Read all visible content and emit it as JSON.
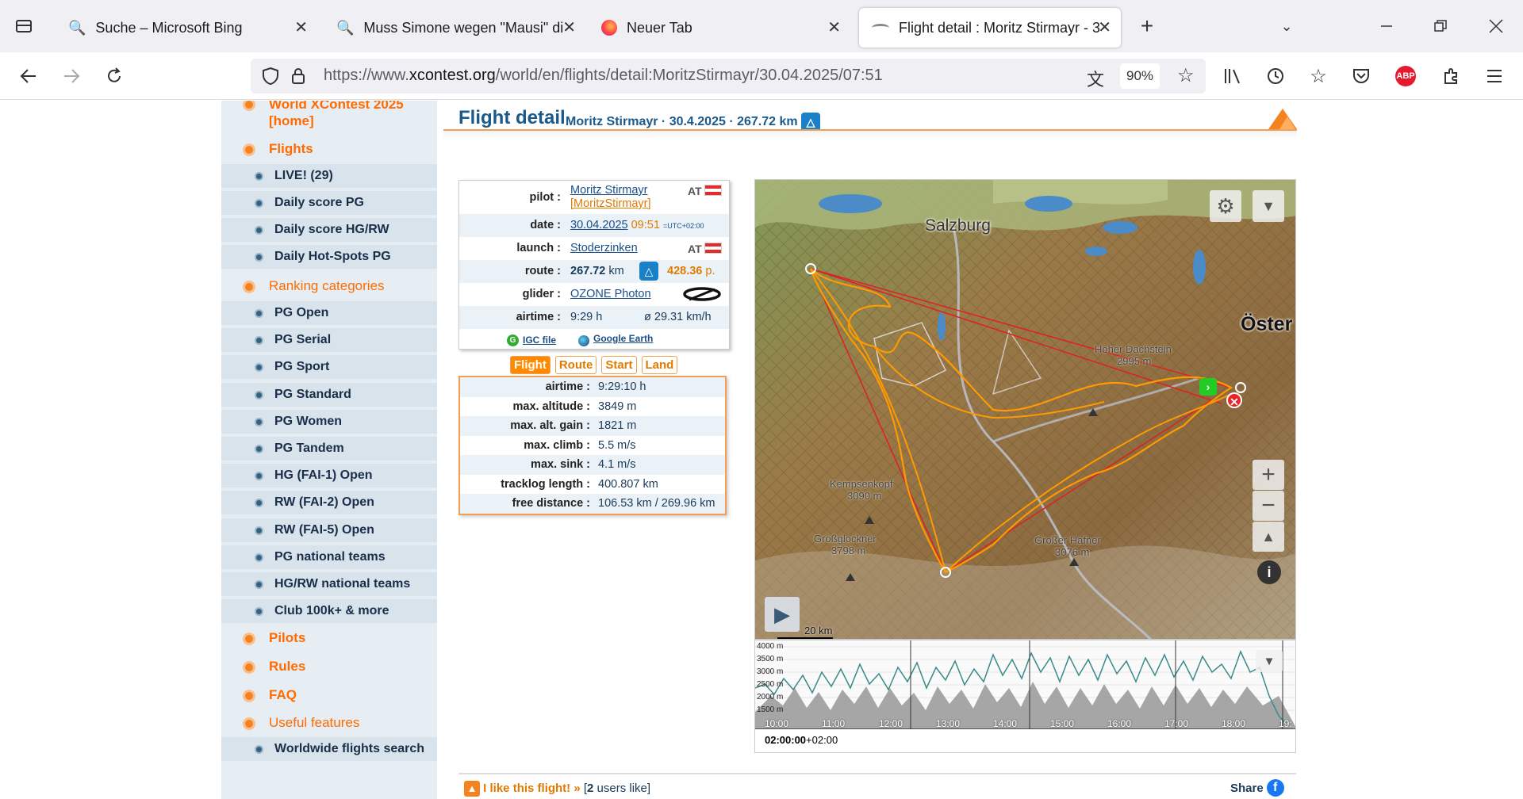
{
  "browser": {
    "tabs": [
      {
        "title": "Suche – Microsoft Bing",
        "icon": "search-icon"
      },
      {
        "title": "Muss Simone wegen \"Mausi\" di",
        "icon": "search-icon"
      },
      {
        "title": "Neuer Tab",
        "icon": "firefox-icon"
      },
      {
        "title": "Flight detail : Moritz Stirmayr - 3",
        "icon": "xcontest-icon"
      }
    ],
    "url_prefix": "https://www.",
    "url_domain": "xcontest.org",
    "url_path": "/world/en/flights/detail:MoritzStirmayr/30.04.2025/07:51",
    "zoom": "90%",
    "abp_label": "ABP"
  },
  "sidebar": {
    "home": "World XContest 2025 [home]",
    "flights": "Flights",
    "flight_items": [
      "LIVE! (29)",
      "Daily score PG",
      "Daily score HG/RW",
      "Daily Hot-Spots PG"
    ],
    "ranking": "Ranking categories",
    "ranking_items": [
      "PG Open",
      "PG Serial",
      "PG Sport",
      "PG Standard",
      "PG Women",
      "PG Tandem",
      "HG (FAI-1) Open",
      "RW (FAI-2) Open",
      "RW (FAI-5) Open",
      "PG national teams",
      "HG/RW national teams",
      "Club 100k+ & more"
    ],
    "pilots": "Pilots",
    "rules": "Rules",
    "faq": "FAQ",
    "useful": "Useful features",
    "useful_items": [
      "Worldwide flights search"
    ]
  },
  "header": {
    "title": "Flight detail",
    "subtitle": "Moritz Stirmayr · 30.4.2025 · 267.72 km"
  },
  "info": {
    "pilot_label": "pilot :",
    "pilot_name": "Moritz Stirmayr",
    "pilot_user": "[MoritzStirmayr]",
    "country": "AT",
    "date_label": "date :",
    "date": "30.04.2025",
    "time": "09:51",
    "tz": "=UTC+02:00",
    "launch_label": "launch :",
    "launch": "Stoderzinken",
    "route_label": "route :",
    "route_km": "267.72",
    "route_unit": "km",
    "route_points": "428.36",
    "points_unit": "p.",
    "glider_label": "glider :",
    "glider": "OZONE Photon",
    "airtime_label": "airtime :",
    "airtime": "9:29 h",
    "speed": "ø 29.31 km/h",
    "igc": "IGC file",
    "google_earth": "Google Earth"
  },
  "flight_tabs": [
    "Flight",
    "Route",
    "Start",
    "Land"
  ],
  "stats": [
    {
      "label": "airtime :",
      "value": "9:29:10 h"
    },
    {
      "label": "max. altitude :",
      "value": "3849 m"
    },
    {
      "label": "max. alt. gain :",
      "value": "1821 m"
    },
    {
      "label": "max. climb :",
      "value": "5.5 m/s"
    },
    {
      "label": "max. sink :",
      "value": "4.1 m/s"
    },
    {
      "label": "tracklog length :",
      "value": "400.807 km"
    },
    {
      "label": "free distance :",
      "value": "106.53 km / 269.96 km"
    }
  ],
  "map": {
    "labels": [
      {
        "text": "Salzburg"
      },
      {
        "text": "Öster"
      },
      {
        "text": "Hoher Dachstein"
      },
      {
        "text": "2995 m"
      },
      {
        "text": "Kempsenkopf"
      },
      {
        "text": "3090 m"
      },
      {
        "text": "Großglockner"
      },
      {
        "text": "3798 m"
      },
      {
        "text": "Großer Hafner"
      },
      {
        "text": "3076 m"
      }
    ],
    "scale": "20 km"
  },
  "chart": {
    "y_labels": [
      "4000 m",
      "3500 m",
      "3000 m",
      "2500 m",
      "2000 m",
      "1500 m"
    ],
    "x_labels": [
      "10:00",
      "11:00",
      "12:00",
      "13:00",
      "14:00",
      "15:00",
      "16:00",
      "17:00",
      "18:00",
      "19:"
    ],
    "time": "02:00:00",
    "time_tz": "+02:00"
  },
  "footer": {
    "like": "I like this flight! »",
    "count_open": "[",
    "count": "2",
    "count_rest": " users like]",
    "share": "Share"
  }
}
